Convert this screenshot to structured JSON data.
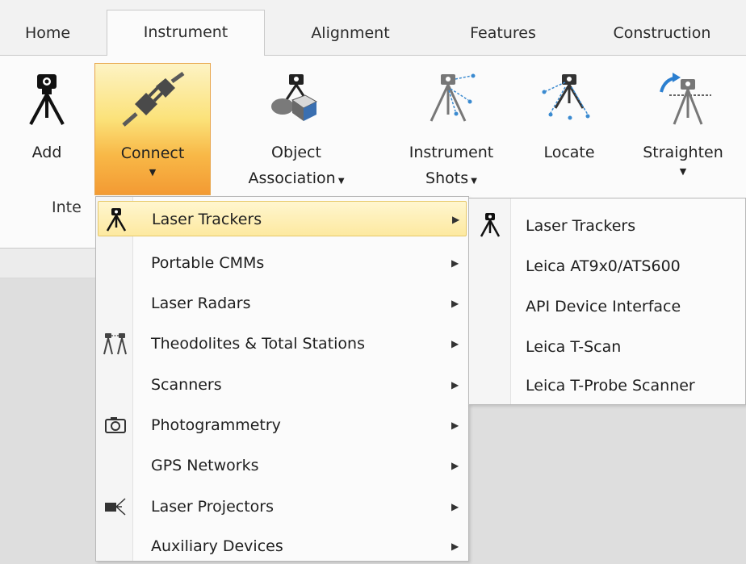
{
  "tabs": [
    {
      "label": "Home"
    },
    {
      "label": "Instrument",
      "active": true
    },
    {
      "label": "Alignment"
    },
    {
      "label": "Features"
    },
    {
      "label": "Construction"
    }
  ],
  "ribbon": {
    "buttons": {
      "add": {
        "label": "Add",
        "icon": "tripod-add-icon"
      },
      "connect": {
        "label": "Connect",
        "icon": "plug-connect-icon",
        "dropdown": true
      },
      "object_association": {
        "label_line1": "Object",
        "label_line2": "Association",
        "icon": "object-association-icon"
      },
      "instrument_shots": {
        "label_line1": "Instrument",
        "label_line2": "Shots",
        "icon": "instrument-shots-icon"
      },
      "locate": {
        "label": "Locate",
        "icon": "locate-icon"
      },
      "straighten": {
        "label": "Straighten",
        "icon": "straighten-icon"
      }
    },
    "group_label": "Inte"
  },
  "connect_menu": {
    "items": [
      {
        "label": "Laser Trackers",
        "icon": "tracker-icon",
        "selected": true
      },
      {
        "label": "Portable CMMs"
      },
      {
        "label": "Laser Radars"
      },
      {
        "label": "Theodolites & Total Stations",
        "icon": "theodolite-icon"
      },
      {
        "label": "Scanners"
      },
      {
        "label": "Photogrammetry",
        "icon": "camera-icon"
      },
      {
        "label": "GPS Networks"
      },
      {
        "label": "Laser Projectors",
        "icon": "projector-icon"
      },
      {
        "label": "Auxiliary Devices"
      }
    ]
  },
  "submenu": {
    "items": [
      {
        "label": "Laser Trackers",
        "icon": "tracker-icon"
      },
      {
        "label": "Leica AT9x0/ATS600"
      },
      {
        "label": "API Device Interface"
      },
      {
        "label": "Leica T-Scan"
      },
      {
        "label": "Leica T-Probe Scanner"
      }
    ]
  },
  "colors": {
    "connect_highlight": "#f8b847",
    "menu_selected": "#fde9a0",
    "accent_blue": "#2b7fd0"
  }
}
